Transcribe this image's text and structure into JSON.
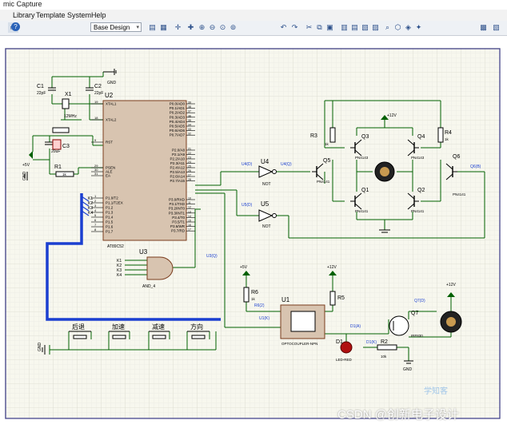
{
  "window": {
    "title": "mic Capture"
  },
  "menu": [
    "Library",
    "Template",
    "System",
    "Help"
  ],
  "toolbar": {
    "design_select": "Base Design"
  },
  "schematic": {
    "crystal": {
      "c1": "C1",
      "c1v": "22pF",
      "c2": "C2",
      "c2v": "22pF",
      "x1": "X1",
      "x1v": "12MHz"
    },
    "gnd_top": "GND",
    "mcu": {
      "ref": "U2",
      "name": "AT89C52",
      "left_pins": [
        {
          "num": "19",
          "name": "XTAL1"
        },
        {
          "num": "18",
          "name": "XTAL2"
        },
        {
          "num": "9",
          "name": "RST"
        },
        {
          "num": "29",
          "name": "PSEN"
        },
        {
          "num": "30",
          "name": "ALE"
        },
        {
          "num": "31",
          "name": "EA"
        },
        {
          "num": "1",
          "name": "P1.0/T2"
        },
        {
          "num": "2",
          "name": "P1.1/T2EX"
        },
        {
          "num": "3",
          "name": "P1.2"
        },
        {
          "num": "4",
          "name": "P1.3"
        },
        {
          "num": "5",
          "name": "P1.4"
        },
        {
          "num": "6",
          "name": "P1.5"
        },
        {
          "num": "7",
          "name": "P1.6"
        },
        {
          "num": "8",
          "name": "P1.7"
        }
      ],
      "right_pins": [
        {
          "num": "39",
          "name": "P0.0/AD0"
        },
        {
          "num": "38",
          "name": "P0.1/AD1"
        },
        {
          "num": "37",
          "name": "P0.2/AD2"
        },
        {
          "num": "36",
          "name": "P0.3/AD3"
        },
        {
          "num": "35",
          "name": "P0.4/AD4"
        },
        {
          "num": "34",
          "name": "P0.5/AD5"
        },
        {
          "num": "33",
          "name": "P0.6/AD6"
        },
        {
          "num": "32",
          "name": "P0.7/AD7"
        },
        {
          "num": "21",
          "name": "P2.0/A8"
        },
        {
          "num": "22",
          "name": "P2.1/A9"
        },
        {
          "num": "23",
          "name": "P2.2/A10"
        },
        {
          "num": "24",
          "name": "P2.3/A11"
        },
        {
          "num": "25",
          "name": "P2.4/A12"
        },
        {
          "num": "26",
          "name": "P2.5/A13"
        },
        {
          "num": "27",
          "name": "P2.6/A14"
        },
        {
          "num": "28",
          "name": "P2.7/A15"
        },
        {
          "num": "10",
          "name": "P3.0/RXD"
        },
        {
          "num": "11",
          "name": "P3.1/TXD"
        },
        {
          "num": "12",
          "name": "P3.2/INT0"
        },
        {
          "num": "13",
          "name": "P3.3/INT1"
        },
        {
          "num": "14",
          "name": "P3.4/T0"
        },
        {
          "num": "15",
          "name": "P3.5/T1"
        },
        {
          "num": "16",
          "name": "P3.6/WR"
        },
        {
          "num": "17",
          "name": "P3.7/RD"
        }
      ]
    },
    "reset": {
      "c3": "C3",
      "c3v": "20uF",
      "r1": "R1",
      "r1v": "1k",
      "vcc": "+5V",
      "gnd": "GND"
    },
    "keys_left": [
      "K1",
      "K2",
      "K3",
      "K4"
    ],
    "and_gate": {
      "ref": "U3",
      "name": "AND_4",
      "keys": [
        "K1",
        "K2",
        "K3",
        "K4"
      ],
      "probe": "U3(Q)"
    },
    "not_gates": [
      {
        "ref": "U4",
        "name": "NOT",
        "probe_in": "U4(D)",
        "probe_out": "U4(Q)"
      },
      {
        "ref": "U5",
        "name": "NOT",
        "probe_in": "U5(D)"
      }
    ],
    "hbridge": {
      "vcc": "+12V",
      "r3": "R3",
      "r3v": "1k",
      "r4": "R4",
      "r4v": "1k",
      "q3": "Q3",
      "q3m": "PN4143",
      "q4": "Q4",
      "q4m": "PN4143",
      "q5": "Q5",
      "q5m": "PN4141",
      "q6": "Q6",
      "q6m": "PN4141",
      "q1": "Q1",
      "q1m": "PN4141",
      "q2": "Q2",
      "q2m": "PN4141",
      "probe_q6": "Q6(B)"
    },
    "opto": {
      "vcc1": "+5V",
      "vcc2": "+12V",
      "r6": "R6",
      "r6v": "1k",
      "probe_r6": "R6(2)",
      "r5": "R5",
      "u1": "U1",
      "u1name": "OPTOCOUPLER-NPN",
      "probe_u1": "U1(K)",
      "d1": "D1",
      "d1name": "LED-RED",
      "probe_d1a": "D1(A)",
      "probe_d1k": "D1(K)",
      "r2": "R2",
      "r2v": "10k",
      "q7": "Q7",
      "q7name": "IRF830",
      "probe_q7": "Q7(D)",
      "vcc3": "+12V",
      "gnd": "GND"
    },
    "buttons": [
      "后退",
      "加速",
      "减速",
      "方向"
    ],
    "gnd_left": "GND"
  },
  "watermark": {
    "csdn": "CSDN @创新电子设计",
    "logo": "学知客"
  }
}
